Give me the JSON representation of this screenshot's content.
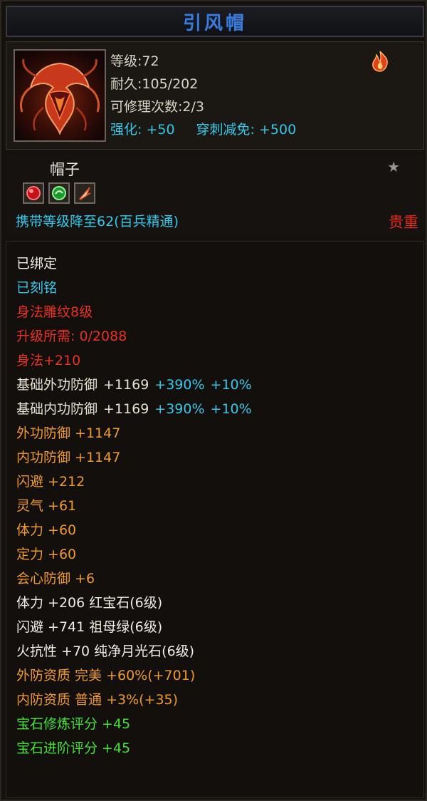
{
  "title": "引风帽",
  "header": {
    "level": "等级:72",
    "durability": "耐久:105/202",
    "repair": "可修理次数:2/3",
    "enhance": "强化: +50",
    "pierce": "穿刺减免: +500"
  },
  "type_label": "帽子",
  "carry": "携带等级降至62(百兵精通)",
  "rarity": "贵重",
  "details": {
    "bound": "已绑定",
    "engraved": "已刻铭",
    "carving": "身法雕纹8级",
    "upgrade": "升级所需: 0/2088",
    "agility": "身法+210",
    "base_ext_def": {
      "label": "基础外功防御",
      "value": "+1169",
      "pct": "+390%",
      "extra": "+10%"
    },
    "base_int_def": {
      "label": "基础内功防御",
      "value": "+1169",
      "pct": "+390%",
      "extra": "+10%"
    },
    "attrs": [
      "外功防御 +1147",
      "内功防御 +1147",
      "闪避 +212",
      "灵气 +61",
      "体力 +60",
      "定力 +60",
      "会心防御 +6"
    ],
    "gems": [
      "体力 +206 红宝石(6级)",
      "闪避 +741 祖母绿(6级)",
      "火抗性 +70 纯净月光石(6级)"
    ],
    "quality": [
      "外防资质  完美 +60%(+701)",
      "内防资质  普通 +3%(+35)"
    ],
    "scores": [
      "宝石修炼评分 +45",
      "宝石进阶评分 +45"
    ]
  },
  "colors": {
    "title": "#3b7bd8",
    "cyan": "#35c8ea",
    "red": "#e83222",
    "orange": "#f09a2c",
    "green": "#44e034"
  },
  "icons": [
    "hat-item-icon",
    "fire-badge-icon",
    "star-icon",
    "red-gem-icon",
    "green-gem-icon",
    "fire-gem-icon"
  ]
}
